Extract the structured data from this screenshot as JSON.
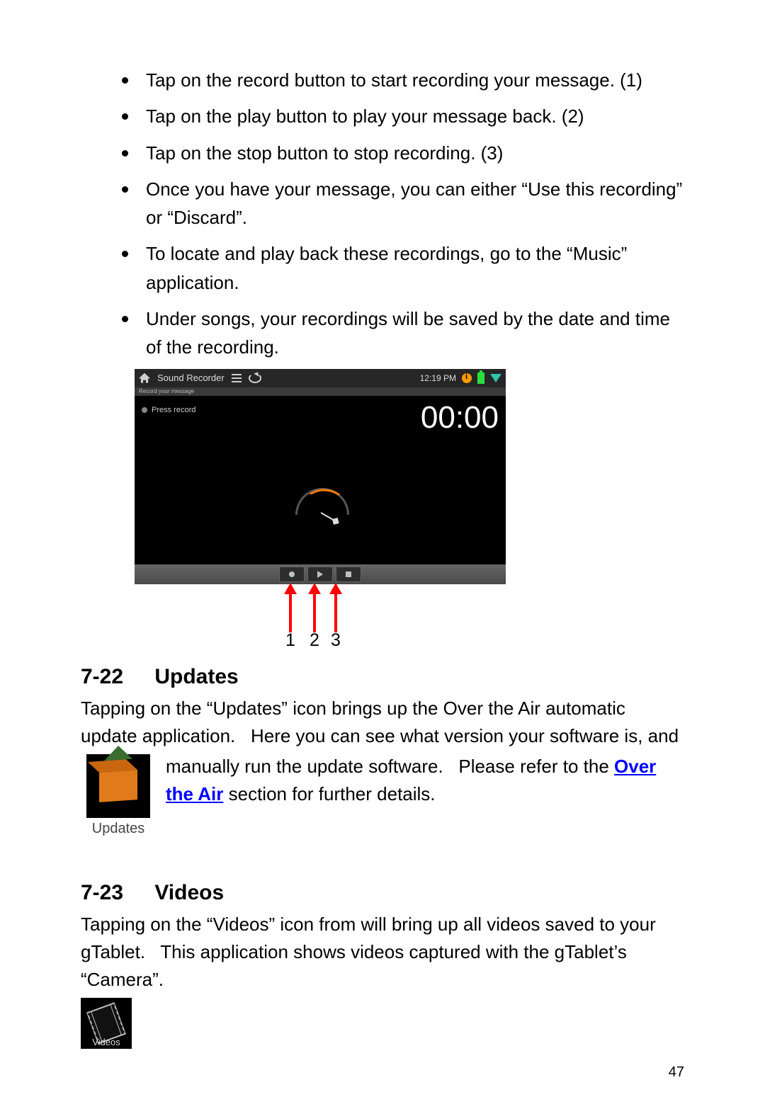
{
  "bullets": [
    "Tap on the record button to start recording your message. (1)",
    "Tap on the play button to play your message back. (2)",
    "Tap on the stop button to stop recording. (3)",
    "Once you have your message, you can either “Use this recording” or “Discard”.",
    "To locate and play back these recordings, go to the “Music” application.",
    "Under songs, your recordings will be saved by the date and time of the recording."
  ],
  "screenshot": {
    "app_title": "Sound Recorder",
    "subbar": "Record your message",
    "press_label": "Press record",
    "time_label": "12:19 PM",
    "timer": "00:00",
    "arrow_labels": [
      "1",
      "2",
      "3"
    ]
  },
  "section_722": {
    "num": "7-22",
    "title": "Updates",
    "para1": "Tapping on the “Updates” icon brings up the Over the Air automatic update application.   Here you can see what version your software is, and ",
    "para2a": "manually run the update software.   Please refer to the ",
    "link": "Over the Air",
    "para2b": " section for further details.",
    "icon_label": "Updates"
  },
  "section_723": {
    "num": "7-23",
    "title": "Videos",
    "para": "Tapping on the “Videos” icon from will bring up all videos saved to your gTablet.   This application shows videos captured with the gTablet’s “Camera”.",
    "icon_label": "Videos"
  },
  "page_number": "47"
}
